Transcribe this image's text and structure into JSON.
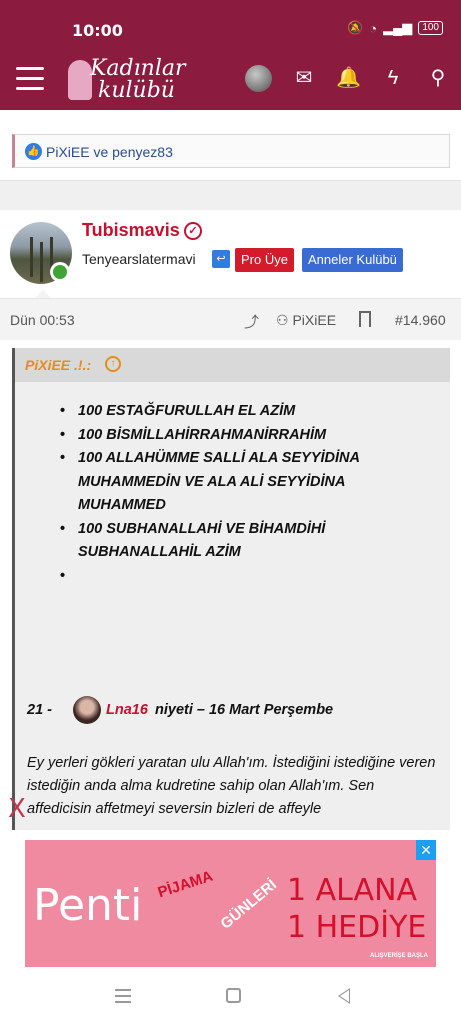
{
  "status_bar": {
    "time": "10:00",
    "battery": "100",
    "icons": [
      "mute-icon",
      "wifi-icon",
      "volte-icon",
      "signal-icon",
      "battery-icon"
    ]
  },
  "navbar": {
    "logo_line1": "Kadınlar",
    "logo_line2": "kulübü",
    "icons": [
      "menu-icon",
      "avatar",
      "mail-icon",
      "bell-icon",
      "bolt-icon",
      "search-icon"
    ],
    "accent_color": "#8b1c3f"
  },
  "prev_post": {
    "likes_text": "PiXiEE ve penyez83"
  },
  "post": {
    "username": "Tubismavis",
    "user_title": "Tenyearslatermavi",
    "badge_pro": "Pro Üye",
    "badge_anneler": "Anneler Kulübü",
    "date": "Dün 00:53",
    "tagged_user": "PiXiEE",
    "post_number": "#14.960",
    "quote": {
      "author": "PiXiEE .!.:",
      "items": [
        "100 ESTAĞFURULLAH EL AZİM",
        "100 BİSMİLLAHİRRAHMANİRRAHİM",
        "100 ALLAHÜMME SALLİ ALA SEYYİDİNA MUHAMMEDİN VE ALA ALİ SEYYİDİNA MUHAMMED",
        "100 SUBHANALLAHİ VE BİHAMDİHİ SUBHANALLAHİL AZİM",
        ""
      ],
      "niyet_number": "21 -",
      "niyet_user": "Lna16",
      "niyet_rest": "niyeti – 16 Mart Perşembe",
      "paragraph": "Ey yerleri gökleri yaratan ulu Allah'ım. İstediğini istediğine veren istediğin anda alma kudretine sahip olan Allah'ım. Sen affedicisin affetmeyi seversin bizleri de affeyle"
    }
  },
  "ad": {
    "close_x": "X",
    "brand": "Penti",
    "line_pijama": "PİJAMA",
    "line_gunleri": "GÜNLERİ",
    "line1": "1 ALANA",
    "line2": "1 HEDİYE",
    "cta": "ALIŞVERİŞE BAŞLA",
    "close_icon": "✕",
    "bg_color": "#f08aa0"
  }
}
